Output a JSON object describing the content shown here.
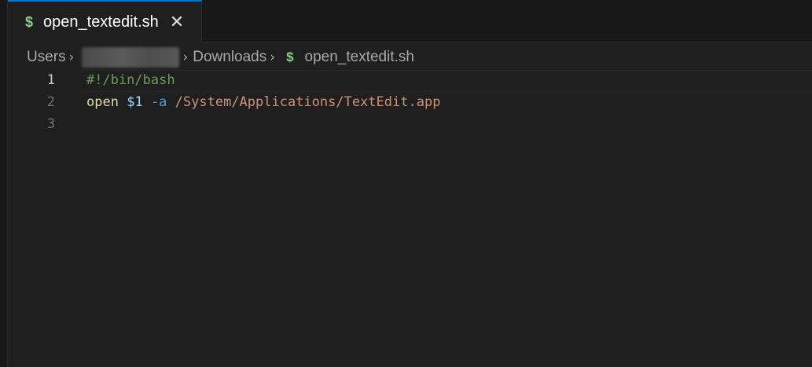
{
  "tab": {
    "icon": "dollar-icon",
    "icon_glyph": "$",
    "label": "open_textedit.sh",
    "close_glyph": "✕"
  },
  "breadcrumb": {
    "items": [
      "Users",
      "Downloads",
      "open_textedit.sh"
    ],
    "file_icon_glyph": "$",
    "separator": "›"
  },
  "editor": {
    "active_line": 1,
    "lines": [
      {
        "number": "1",
        "text": "#!/bin/bash"
      },
      {
        "number": "2",
        "tokens": [
          "open",
          " ",
          "$1",
          " ",
          "-a",
          " ",
          "/System/Applications/TextEdit.app"
        ]
      },
      {
        "number": "3",
        "text": ""
      }
    ]
  },
  "colors": {
    "accent": "#0078d4",
    "shell_icon": "#89d185",
    "comment": "#6a9955",
    "command": "#dcdcaa",
    "variable": "#9cdcfe",
    "flag": "#569cd6",
    "string": "#ce9178",
    "background": "#1f1f1f"
  }
}
